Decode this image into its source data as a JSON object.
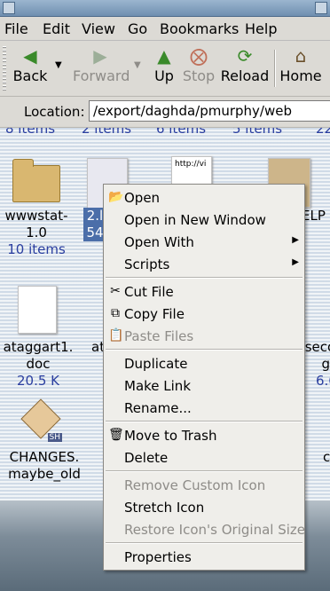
{
  "menubar": {
    "items": [
      "File",
      "Edit",
      "View",
      "Go",
      "Bookmarks",
      "Help"
    ]
  },
  "toolbar": {
    "back": "Back",
    "forward": "Forward",
    "up": "Up",
    "stop": "Stop",
    "reload": "Reload",
    "home": "Home"
  },
  "location": {
    "label": "Location:",
    "value": "/export/daghda/pmurphy/web"
  },
  "icon_view": {
    "top_counts": [
      "8 items",
      "2 items",
      "6 items",
      "5 items",
      "22"
    ],
    "items": [
      {
        "name1": "wwwstat-",
        "name2": "1.0",
        "sub": "10 items"
      },
      {
        "name1": "2.l",
        "sub": "54"
      },
      {
        "thumb_text": "http://vi"
      },
      {
        "name1": "ELP"
      },
      {
        "name1": "ataggart1.",
        "name2": "doc",
        "sub": "20.5 K"
      },
      {
        "name1": "at"
      },
      {
        "name1": "seco",
        "name2": "g",
        "sub": "6.6"
      },
      {
        "name1": "CHANGES.",
        "name2": "maybe_old",
        "badge": "SH"
      },
      {
        "name1": "c"
      }
    ]
  },
  "context_menu": {
    "items": [
      {
        "label": "Open",
        "icon": "folder-open-icon",
        "enabled": true
      },
      {
        "label": "Open in New Window",
        "enabled": true
      },
      {
        "label": "Open With",
        "enabled": true,
        "submenu": true
      },
      {
        "label": "Scripts",
        "enabled": true,
        "submenu": true
      },
      {
        "label": "Cut File",
        "icon": "scissors-icon",
        "enabled": true
      },
      {
        "label": "Copy File",
        "icon": "copy-icon",
        "enabled": true
      },
      {
        "label": "Paste Files",
        "icon": "paste-icon",
        "enabled": false
      },
      {
        "label": "Duplicate",
        "enabled": true
      },
      {
        "label": "Make Link",
        "enabled": true
      },
      {
        "label": "Rename...",
        "enabled": true
      },
      {
        "label": "Move to Trash",
        "icon": "trash-icon",
        "enabled": true
      },
      {
        "label": "Delete",
        "enabled": true
      },
      {
        "label": "Remove Custom Icon",
        "enabled": false
      },
      {
        "label": "Stretch Icon",
        "enabled": true
      },
      {
        "label": "Restore Icon's Original Size",
        "enabled": false
      },
      {
        "label": "Properties",
        "enabled": true
      }
    ]
  },
  "colors": {
    "menu_bg": "#efeeea",
    "disabled_text": "#8e8c88",
    "sub_text": "#2b3fa0",
    "selection": "#4b6ea9"
  }
}
